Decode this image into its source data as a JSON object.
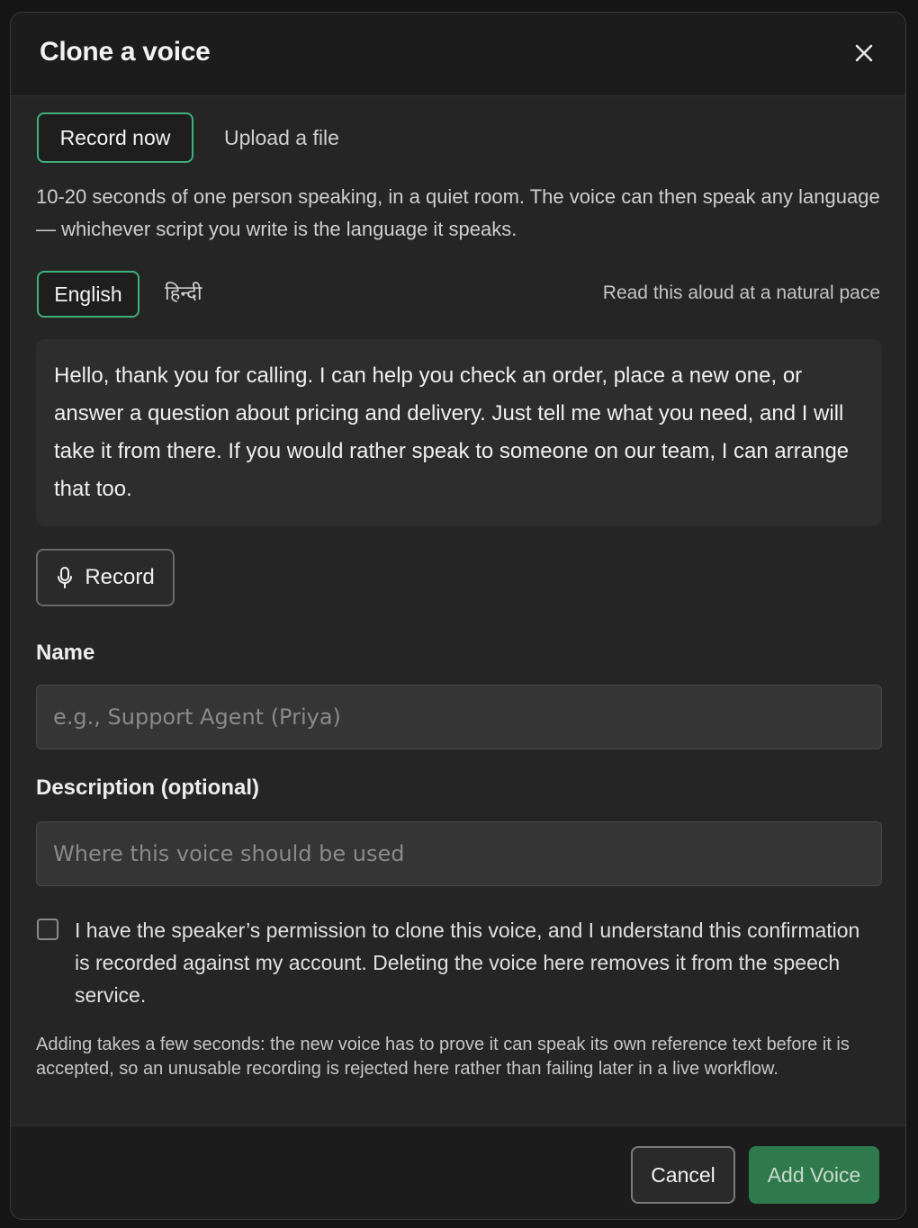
{
  "header": {
    "title": "Clone a voice",
    "close_icon": "close-icon"
  },
  "source_tabs": [
    {
      "label": "Record now",
      "selected": true
    },
    {
      "label": "Upload a file",
      "selected": false
    }
  ],
  "help_text": "10-20 seconds of one person speaking, in a quiet room. The voice can then speak any language — whichever script you write is the language it speaks.",
  "language_tabs": [
    {
      "label": "English",
      "selected": true
    },
    {
      "label": "हिन्दी",
      "selected": false
    }
  ],
  "read_hint": "Read this aloud at a natural pace",
  "script_text": "Hello, thank you for calling. I can help you check an order, place a new one, or answer a question about pricing and delivery. Just tell me what you need, and I will take it from there. If you would rather speak to someone on our team, I can arrange that too.",
  "record_button": {
    "label": "Record",
    "icon": "microphone-icon"
  },
  "name_field": {
    "label": "Name",
    "value": "",
    "placeholder": "e.g., Support Agent (Priya)"
  },
  "description_field": {
    "label": "Description (optional)",
    "value": "",
    "placeholder": "Where this voice should be used"
  },
  "consent": {
    "checked": false,
    "text": "I have the speaker’s permission to clone this voice, and I understand this confirmation is recorded against my account. Deleting the voice here removes it from the speech service."
  },
  "note": "Adding takes a few seconds: the new voice has to prove it can speak its own reference text before it is accepted, so an unusable recording is rejected here rather than failing later in a live workflow.",
  "footer": {
    "cancel_label": "Cancel",
    "add_label": "Add Voice"
  },
  "colors": {
    "accent": "#3fb07a",
    "primary_button": "#2f7a4c",
    "background": "#252525"
  }
}
